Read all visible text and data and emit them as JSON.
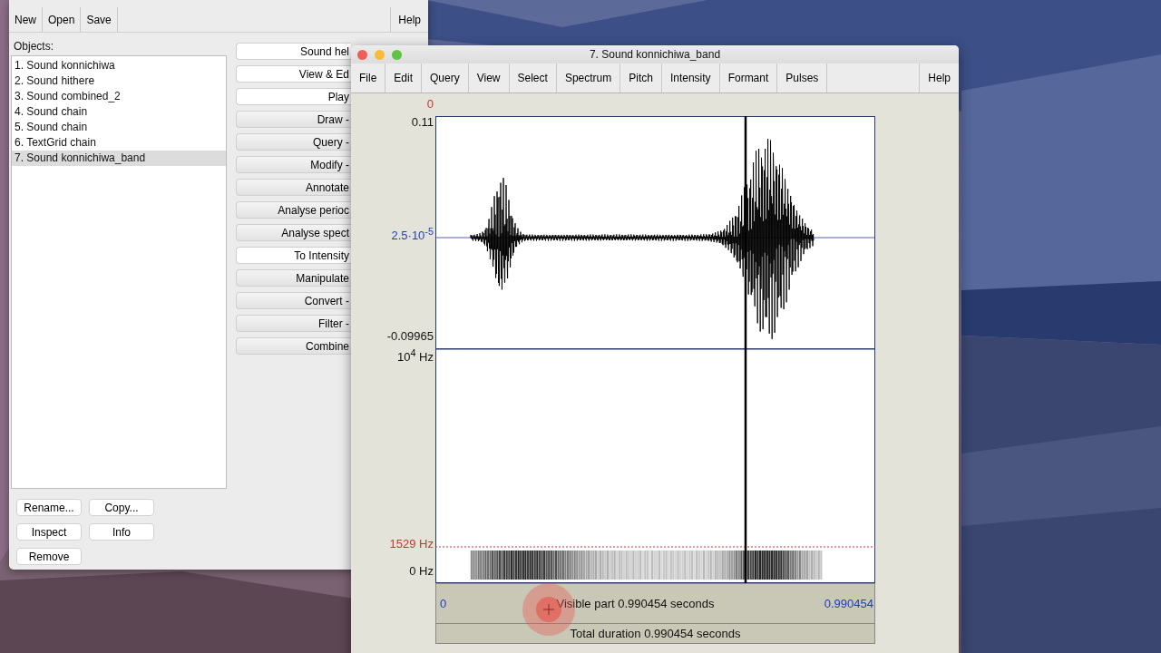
{
  "objects_window": {
    "toolbar": [
      "New",
      "Open",
      "Save"
    ],
    "help_button": "Help",
    "objects_label": "Objects:",
    "objects": [
      {
        "label": "1. Sound konnichiwa",
        "selected": false
      },
      {
        "label": "2. Sound hithere",
        "selected": false
      },
      {
        "label": "3. Sound combined_2",
        "selected": false
      },
      {
        "label": "4. Sound chain",
        "selected": false
      },
      {
        "label": "5. Sound chain",
        "selected": false
      },
      {
        "label": "6. TextGrid chain",
        "selected": false
      },
      {
        "label": "7. Sound konnichiwa_band",
        "selected": true
      }
    ],
    "actions": [
      {
        "label": "Sound hel",
        "kind": "action"
      },
      {
        "label": "View & Ed",
        "kind": "action"
      },
      {
        "label": "Play",
        "kind": "action"
      },
      {
        "label": "Draw -",
        "kind": "menu"
      },
      {
        "label": "Query -",
        "kind": "menu"
      },
      {
        "label": "Modify -",
        "kind": "menu"
      },
      {
        "label": "Annotate",
        "kind": "menu"
      },
      {
        "label": "Analyse perioc",
        "kind": "menu"
      },
      {
        "label": "Analyse spect",
        "kind": "menu"
      },
      {
        "label": "To Intensity",
        "kind": "action"
      },
      {
        "label": "Manipulate",
        "kind": "menu"
      },
      {
        "label": "Convert -",
        "kind": "menu"
      },
      {
        "label": "Filter -",
        "kind": "menu"
      },
      {
        "label": "Combine",
        "kind": "menu"
      }
    ],
    "bottom_buttons": [
      "Rename...",
      "Copy...",
      "Inspect",
      "Info",
      "Remove"
    ]
  },
  "editor": {
    "title": "7. Sound konnichiwa_band",
    "menus": [
      "File",
      "Edit",
      "Query",
      "View",
      "Select",
      "Spectrum",
      "Pitch",
      "Intensity",
      "Formant",
      "Pulses"
    ],
    "help_menu": "Help",
    "cursor_time": "0",
    "amplitude": {
      "max": "0.11",
      "zero": "2.5·10$^{-5}$",
      "min": "-0.09965"
    },
    "frequency": {
      "max": "10$^{4}$ Hz",
      "marker": "1529 Hz",
      "min": "0 Hz"
    },
    "visible_bar": {
      "start": "0",
      "label": "Visible part 0.990454 seconds",
      "end": "0.990454"
    },
    "total_bar": "Total duration 0.990454 seconds"
  }
}
